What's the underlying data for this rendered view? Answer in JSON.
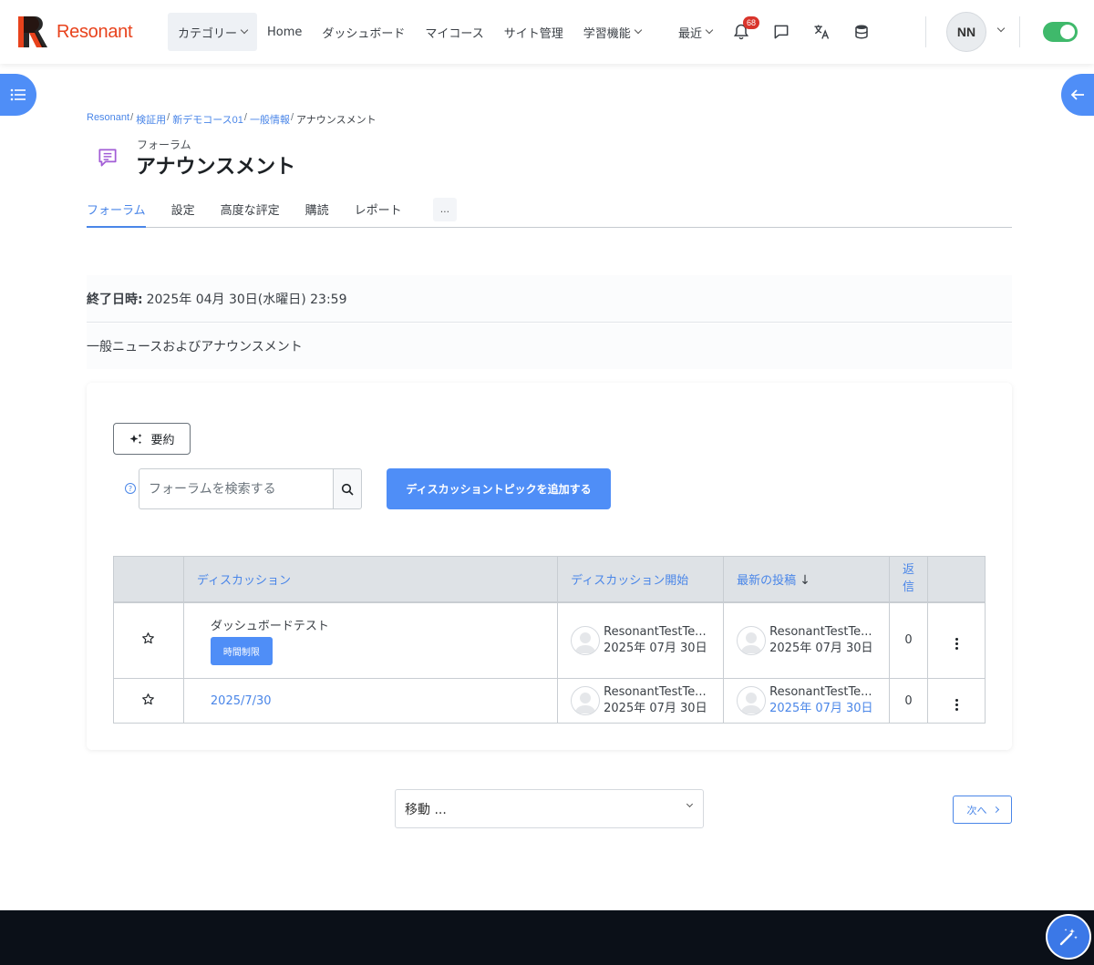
{
  "brand": {
    "name": "Resonant",
    "color": "#e8421c"
  },
  "nav": {
    "items": [
      {
        "label": "カテゴリー"
      },
      {
        "label": "Home"
      },
      {
        "label": "ダッシュボード"
      },
      {
        "label": "マイコース"
      },
      {
        "label": "サイト管理"
      },
      {
        "label": "学習機能"
      }
    ],
    "recent_label": "最近",
    "notification_count": "68",
    "user_initials": "NN"
  },
  "breadcrumb": {
    "items": [
      "Resonant",
      "検証用",
      "新デモコース01",
      "一般情報"
    ],
    "current": "アナウンスメント"
  },
  "page": {
    "subtitle": "フォーラム",
    "title": "アナウンスメント"
  },
  "tabs": [
    {
      "label": "フォーラム",
      "active": true
    },
    {
      "label": "設定"
    },
    {
      "label": "高度な評定"
    },
    {
      "label": "購読"
    },
    {
      "label": "レポート"
    },
    {
      "label": "..."
    }
  ],
  "info": {
    "due_label": "終了日時:",
    "due_value": "2025年 04月 30日(水曜日) 23:59",
    "description": "一般ニュースおよびアナウンスメント"
  },
  "forum": {
    "summary_label": "要約",
    "search_placeholder": "フォーラムを検索する",
    "add_label": "ディスカッショントピックを追加する",
    "columns": {
      "discussion": "ディスカッション",
      "started": "ディスカッション開始",
      "last_post": "最新の投稿",
      "replies": "返信"
    },
    "rows": [
      {
        "title": "ダッシュボードテスト",
        "tag": "時間制限",
        "starter": "ResonantTestTe...",
        "start_date": "2025年 07月 30日",
        "last_user": "ResonantTestTe...",
        "last_date": "2025年 07月 30日",
        "replies": "0"
      },
      {
        "title": "2025/7/30",
        "starter": "ResonantTestTe...",
        "start_date": "2025年 07月 30日",
        "last_user": "ResonantTestTe...",
        "last_date": "2025年 07月 30日",
        "replies": "0"
      }
    ]
  },
  "bottom": {
    "jump_label": "移動 ...",
    "next_label": "次へ"
  },
  "colors": {
    "accent": "#4f8ef7",
    "link": "#4a86e8",
    "toggle": "#3fb96b",
    "badge": "#d9342b"
  },
  "icons": [
    "bell-icon",
    "chat-icon",
    "translate-icon",
    "database-icon",
    "list-icon",
    "arrow-left-icon",
    "forum-icon",
    "sparkle-icon",
    "search-icon",
    "star-icon",
    "kebab-icon",
    "magic-wand-icon",
    "help-icon"
  ]
}
